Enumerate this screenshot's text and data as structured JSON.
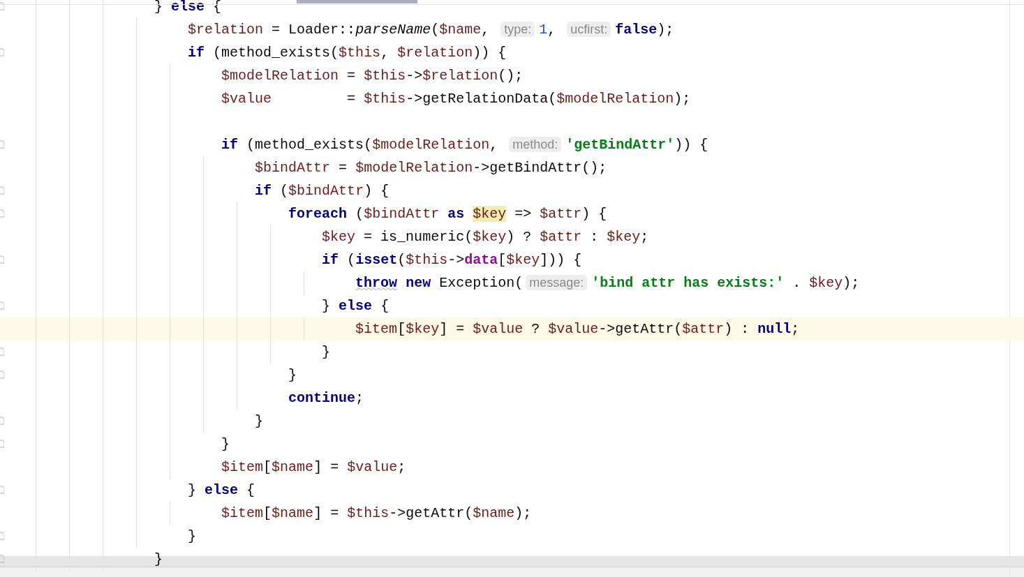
{
  "editor": {
    "lines": [
      {
        "fold": true,
        "current": false,
        "tokens": [
          {
            "kind": "plain",
            "text": "                } "
          },
          {
            "kind": "kw",
            "text": "else"
          },
          {
            "kind": "plain",
            "text": " {"
          }
        ]
      },
      {
        "fold": false,
        "current": false,
        "tokens": [
          {
            "kind": "var",
            "text": "                    $relation"
          },
          {
            "kind": "plain",
            "text": " = Loader::"
          },
          {
            "kind": "fn",
            "text": "parseName"
          },
          {
            "kind": "plain",
            "text": "("
          },
          {
            "kind": "var",
            "text": "$name"
          },
          {
            "kind": "plain",
            "text": ", "
          },
          {
            "kind": "hint",
            "text": "type:"
          },
          {
            "kind": "num",
            "text": "1"
          },
          {
            "kind": "plain",
            "text": ", "
          },
          {
            "kind": "hint",
            "text": "ucfirst:"
          },
          {
            "kind": "kw",
            "text": "false"
          },
          {
            "kind": "plain",
            "text": ");"
          }
        ]
      },
      {
        "fold": true,
        "current": false,
        "tokens": [
          {
            "kind": "kw",
            "text": "                    if"
          },
          {
            "kind": "plain",
            "text": " (method_exists("
          },
          {
            "kind": "var",
            "text": "$this"
          },
          {
            "kind": "plain",
            "text": ", "
          },
          {
            "kind": "var",
            "text": "$relation"
          },
          {
            "kind": "plain",
            "text": ")) {"
          }
        ]
      },
      {
        "fold": false,
        "current": false,
        "tokens": [
          {
            "kind": "var",
            "text": "                        $modelRelation"
          },
          {
            "kind": "plain",
            "text": " = "
          },
          {
            "kind": "var",
            "text": "$this"
          },
          {
            "kind": "plain",
            "text": "->"
          },
          {
            "kind": "var",
            "text": "$relation"
          },
          {
            "kind": "plain",
            "text": "();"
          }
        ]
      },
      {
        "fold": false,
        "current": false,
        "tokens": [
          {
            "kind": "var",
            "text": "                        $value"
          },
          {
            "kind": "plain",
            "text": "         = "
          },
          {
            "kind": "var",
            "text": "$this"
          },
          {
            "kind": "plain",
            "text": "->getRelationData("
          },
          {
            "kind": "var",
            "text": "$modelRelation"
          },
          {
            "kind": "plain",
            "text": ");"
          }
        ]
      },
      {
        "fold": false,
        "current": false
      },
      {
        "fold": true,
        "current": false,
        "tokens": [
          {
            "kind": "kw",
            "text": "                        if"
          },
          {
            "kind": "plain",
            "text": " (method_exists("
          },
          {
            "kind": "var",
            "text": "$modelRelation"
          },
          {
            "kind": "plain",
            "text": ", "
          },
          {
            "kind": "hint",
            "text": "method:"
          },
          {
            "kind": "str",
            "text": "'getBindAttr'"
          },
          {
            "kind": "plain",
            "text": ")) {"
          }
        ]
      },
      {
        "fold": false,
        "current": false,
        "tokens": [
          {
            "kind": "var",
            "text": "                            $bindAttr"
          },
          {
            "kind": "plain",
            "text": " = "
          },
          {
            "kind": "var",
            "text": "$modelRelation"
          },
          {
            "kind": "plain",
            "text": "->getBindAttr();"
          }
        ]
      },
      {
        "fold": true,
        "current": false,
        "tokens": [
          {
            "kind": "kw",
            "text": "                            if"
          },
          {
            "kind": "plain",
            "text": " ("
          },
          {
            "kind": "var",
            "text": "$bindAttr"
          },
          {
            "kind": "plain",
            "text": ") {"
          }
        ]
      },
      {
        "fold": true,
        "current": false,
        "tokens": [
          {
            "kind": "kw",
            "text": "                                foreach"
          },
          {
            "kind": "plain",
            "text": " ("
          },
          {
            "kind": "var",
            "text": "$bindAttr"
          },
          {
            "kind": "kw",
            "text": " as "
          },
          {
            "kind": "var_hl",
            "text": "$key"
          },
          {
            "kind": "plain",
            "text": " => "
          },
          {
            "kind": "var",
            "text": "$attr"
          },
          {
            "kind": "plain",
            "text": ") {"
          }
        ]
      },
      {
        "fold": false,
        "current": false,
        "tokens": [
          {
            "kind": "var",
            "text": "                                    $key"
          },
          {
            "kind": "plain",
            "text": " = is_numeric("
          },
          {
            "kind": "var",
            "text": "$key"
          },
          {
            "kind": "plain",
            "text": ") ? "
          },
          {
            "kind": "var",
            "text": "$attr"
          },
          {
            "kind": "plain",
            "text": " : "
          },
          {
            "kind": "var",
            "text": "$key"
          },
          {
            "kind": "plain",
            "text": ";"
          }
        ]
      },
      {
        "fold": true,
        "current": false,
        "tokens": [
          {
            "kind": "kw",
            "text": "                                    if"
          },
          {
            "kind": "plain",
            "text": " ("
          },
          {
            "kind": "kw",
            "text": "isset"
          },
          {
            "kind": "plain",
            "text": "("
          },
          {
            "kind": "var",
            "text": "$this"
          },
          {
            "kind": "plain",
            "text": "->"
          },
          {
            "kind": "field",
            "text": "data"
          },
          {
            "kind": "plain",
            "text": "["
          },
          {
            "kind": "var",
            "text": "$key"
          },
          {
            "kind": "plain",
            "text": "])) {"
          }
        ]
      },
      {
        "fold": false,
        "current": false,
        "tokens": [
          {
            "kind": "kw_warn",
            "text": "                                        throw"
          },
          {
            "kind": "kw",
            "text": " new"
          },
          {
            "kind": "plain",
            "text": " Exception("
          },
          {
            "kind": "hint",
            "text": "message:"
          },
          {
            "kind": "str",
            "text": "'bind attr has exists:'"
          },
          {
            "kind": "plain",
            "text": " . "
          },
          {
            "kind": "var",
            "text": "$key"
          },
          {
            "kind": "plain",
            "text": ");"
          }
        ]
      },
      {
        "fold": true,
        "current": false,
        "tokens": [
          {
            "kind": "plain",
            "text": "                                    } "
          },
          {
            "kind": "kw",
            "text": "else"
          },
          {
            "kind": "plain",
            "text": " {"
          }
        ]
      },
      {
        "fold": false,
        "current": true,
        "tokens": [
          {
            "kind": "var",
            "text": "                                        $item"
          },
          {
            "kind": "plain",
            "text": "["
          },
          {
            "kind": "var",
            "text": "$key"
          },
          {
            "kind": "plain",
            "text": "] = "
          },
          {
            "kind": "var",
            "text": "$value"
          },
          {
            "kind": "plain",
            "text": " ? "
          },
          {
            "kind": "var",
            "text": "$value"
          },
          {
            "kind": "plain",
            "text": "->getAttr("
          },
          {
            "kind": "var",
            "text": "$attr"
          },
          {
            "kind": "plain",
            "text": ") : "
          },
          {
            "kind": "kw",
            "text": "null"
          },
          {
            "kind": "plain",
            "text": ";"
          }
        ]
      },
      {
        "fold": true,
        "current": false,
        "tokens": [
          {
            "kind": "plain",
            "text": "                                    }"
          }
        ]
      },
      {
        "fold": true,
        "current": false,
        "tokens": [
          {
            "kind": "plain",
            "text": "                                }"
          }
        ]
      },
      {
        "fold": false,
        "current": false,
        "tokens": [
          {
            "kind": "kw",
            "text": "                                continue"
          },
          {
            "kind": "plain",
            "text": ";"
          }
        ]
      },
      {
        "fold": true,
        "current": false,
        "tokens": [
          {
            "kind": "plain",
            "text": "                            }"
          }
        ]
      },
      {
        "fold": true,
        "current": false,
        "tokens": [
          {
            "kind": "plain",
            "text": "                        }"
          }
        ]
      },
      {
        "fold": false,
        "current": false,
        "tokens": [
          {
            "kind": "var",
            "text": "                        $item"
          },
          {
            "kind": "plain",
            "text": "["
          },
          {
            "kind": "var",
            "text": "$name"
          },
          {
            "kind": "plain",
            "text": "] = "
          },
          {
            "kind": "var",
            "text": "$value"
          },
          {
            "kind": "plain",
            "text": ";"
          }
        ]
      },
      {
        "fold": true,
        "current": false,
        "tokens": [
          {
            "kind": "plain",
            "text": "                    } "
          },
          {
            "kind": "kw",
            "text": "else"
          },
          {
            "kind": "plain",
            "text": " {"
          }
        ]
      },
      {
        "fold": false,
        "current": false,
        "tokens": [
          {
            "kind": "var",
            "text": "                        $item"
          },
          {
            "kind": "plain",
            "text": "["
          },
          {
            "kind": "var",
            "text": "$name"
          },
          {
            "kind": "plain",
            "text": "] = "
          },
          {
            "kind": "var",
            "text": "$this"
          },
          {
            "kind": "plain",
            "text": "->getAttr("
          },
          {
            "kind": "var",
            "text": "$name"
          },
          {
            "kind": "plain",
            "text": ");"
          }
        ]
      },
      {
        "fold": true,
        "current": false,
        "tokens": [
          {
            "kind": "plain",
            "text": "                    }"
          }
        ]
      },
      {
        "fold": true,
        "current": false,
        "tokens": [
          {
            "kind": "plain",
            "text": "                }"
          }
        ]
      }
    ]
  }
}
